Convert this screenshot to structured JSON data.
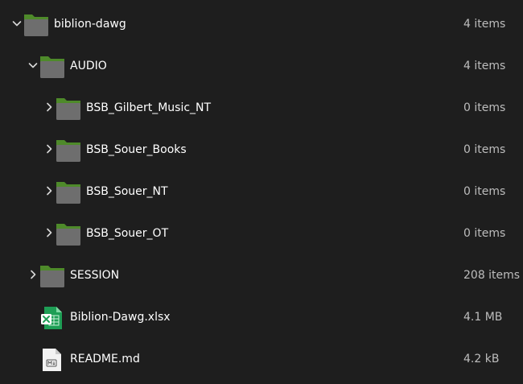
{
  "tree": {
    "rows": [
      {
        "name": "biblion-dawg",
        "size": "4 items",
        "type": "folder",
        "expanded": true,
        "icon": "folder-icon"
      },
      {
        "name": "AUDIO",
        "size": "4 items",
        "type": "folder",
        "expanded": true,
        "icon": "folder-icon"
      },
      {
        "name": "BSB_Gilbert_Music_NT",
        "size": "0 items",
        "type": "folder",
        "expanded": false,
        "icon": "folder-icon"
      },
      {
        "name": "BSB_Souer_Books",
        "size": "0 items",
        "type": "folder",
        "expanded": false,
        "icon": "folder-icon"
      },
      {
        "name": "BSB_Souer_NT",
        "size": "0 items",
        "type": "folder",
        "expanded": false,
        "icon": "folder-icon"
      },
      {
        "name": "BSB_Souer_OT",
        "size": "0 items",
        "type": "folder",
        "expanded": false,
        "icon": "folder-icon"
      },
      {
        "name": "SESSION",
        "size": "208 items",
        "type": "folder",
        "expanded": false,
        "icon": "folder-icon"
      },
      {
        "name": "Biblion-Dawg.xlsx",
        "size": "4.1 MB",
        "type": "spreadsheet",
        "icon": "spreadsheet-icon"
      },
      {
        "name": "README.md",
        "size": "4.2 kB",
        "type": "markdown",
        "icon": "markdown-file-icon"
      }
    ]
  },
  "colors": {
    "background": "#1e1e1e",
    "folder_tab": "#4e8a2a",
    "folder_body": "#6e6e6e",
    "size_text": "#bdbdbd",
    "spreadsheet": "#1e9e55"
  }
}
